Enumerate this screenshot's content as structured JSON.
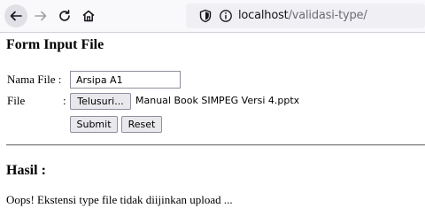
{
  "browser": {
    "url_host": "localhost",
    "url_path": "/validasi-type/",
    "icons": [
      "back-arrow-icon",
      "forward-arrow-icon",
      "reload-icon",
      "home-icon",
      "shield-icon",
      "info-icon"
    ]
  },
  "form": {
    "title": "Form Input File",
    "nama_label": "Nama File :",
    "nama_value": "Arsipa A1",
    "file_label": "File",
    "file_colon": ":",
    "browse_label": "Telusuri...",
    "file_name": "Manual Book SIMPEG Versi 4.pptx",
    "submit_label": "Submit",
    "reset_label": "Reset"
  },
  "result": {
    "title": "Hasil :",
    "message": "Oops! Ekstensi type file tidak diijinkan upload ..."
  },
  "colors": {
    "toolbar_bg": "#f9f9fb",
    "urlbar_bg": "#f0f0f4",
    "button_bg": "#e9e9ed"
  }
}
